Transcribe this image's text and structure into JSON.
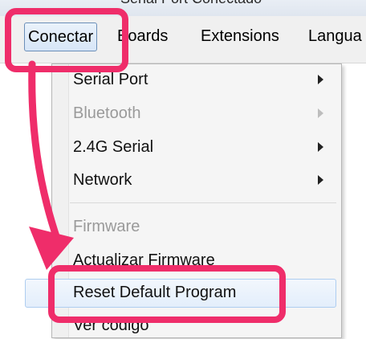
{
  "window": {
    "title_fragment": "Serial Port Conectado"
  },
  "menubar": {
    "items": [
      "Conectar",
      "Boards",
      "Extensions",
      "Langua"
    ]
  },
  "dropdown": {
    "items": [
      {
        "label": "Serial Port",
        "submenu": true,
        "disabled": false
      },
      {
        "label": "Bluetooth",
        "submenu": true,
        "disabled": true
      },
      {
        "label": "2.4G Serial",
        "submenu": true,
        "disabled": false
      },
      {
        "label": "Network",
        "submenu": true,
        "disabled": false
      },
      {
        "label": "Firmware",
        "submenu": false,
        "disabled": true
      },
      {
        "label": "Actualizar Firmware",
        "submenu": false,
        "disabled": false
      },
      {
        "label": "Reset Default Program",
        "submenu": false,
        "disabled": false,
        "highlighted": true
      },
      {
        "label": "Ver código",
        "submenu": false,
        "disabled": false
      }
    ]
  },
  "annotation": {
    "color": "#ef2d6a"
  }
}
